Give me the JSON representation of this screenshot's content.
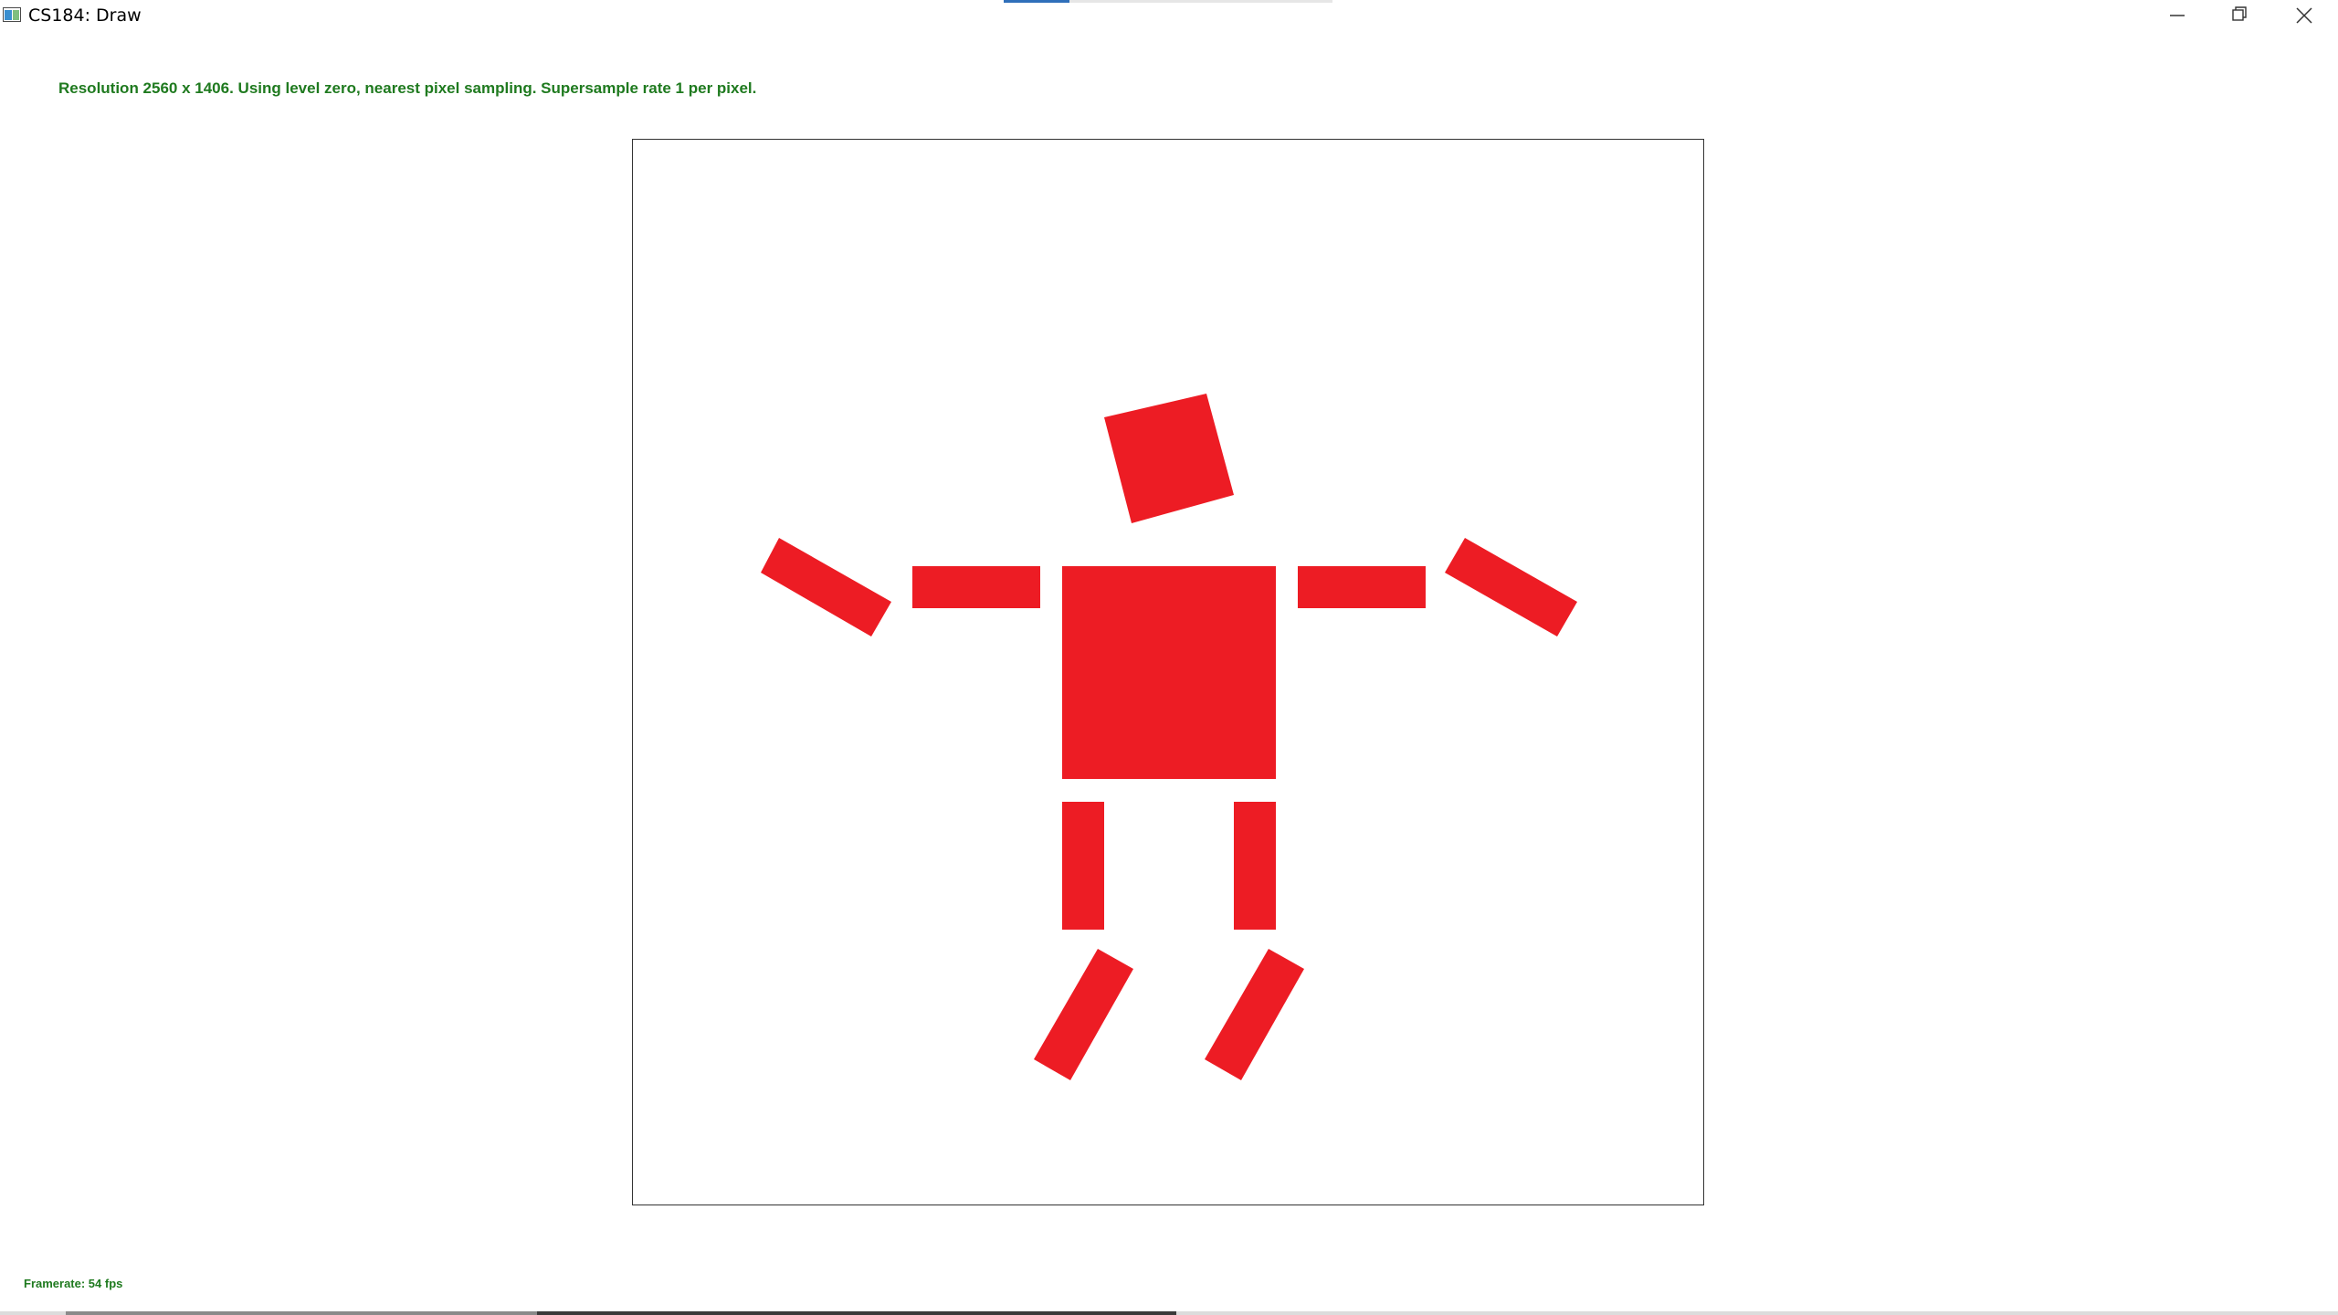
{
  "window": {
    "title": "CS184: Draw",
    "icon": "app-window-icon",
    "controls": [
      "minimize-icon",
      "restore-icon",
      "close-icon"
    ]
  },
  "status": {
    "text": "Resolution 2560 x 1406. Using level zero, nearest pixel sampling. Supersample rate 1 per pixel.",
    "color": "#1f7a1f"
  },
  "footer": {
    "framerate": "Framerate: 54 fps"
  },
  "scene": {
    "fill_color": "#ed1c24",
    "border_color": "#333333",
    "shapes": [
      "head",
      "torso",
      "left-upper-arm",
      "left-forearm",
      "right-upper-arm",
      "right-forearm",
      "left-thigh",
      "left-shin",
      "right-thigh",
      "right-shin"
    ]
  }
}
